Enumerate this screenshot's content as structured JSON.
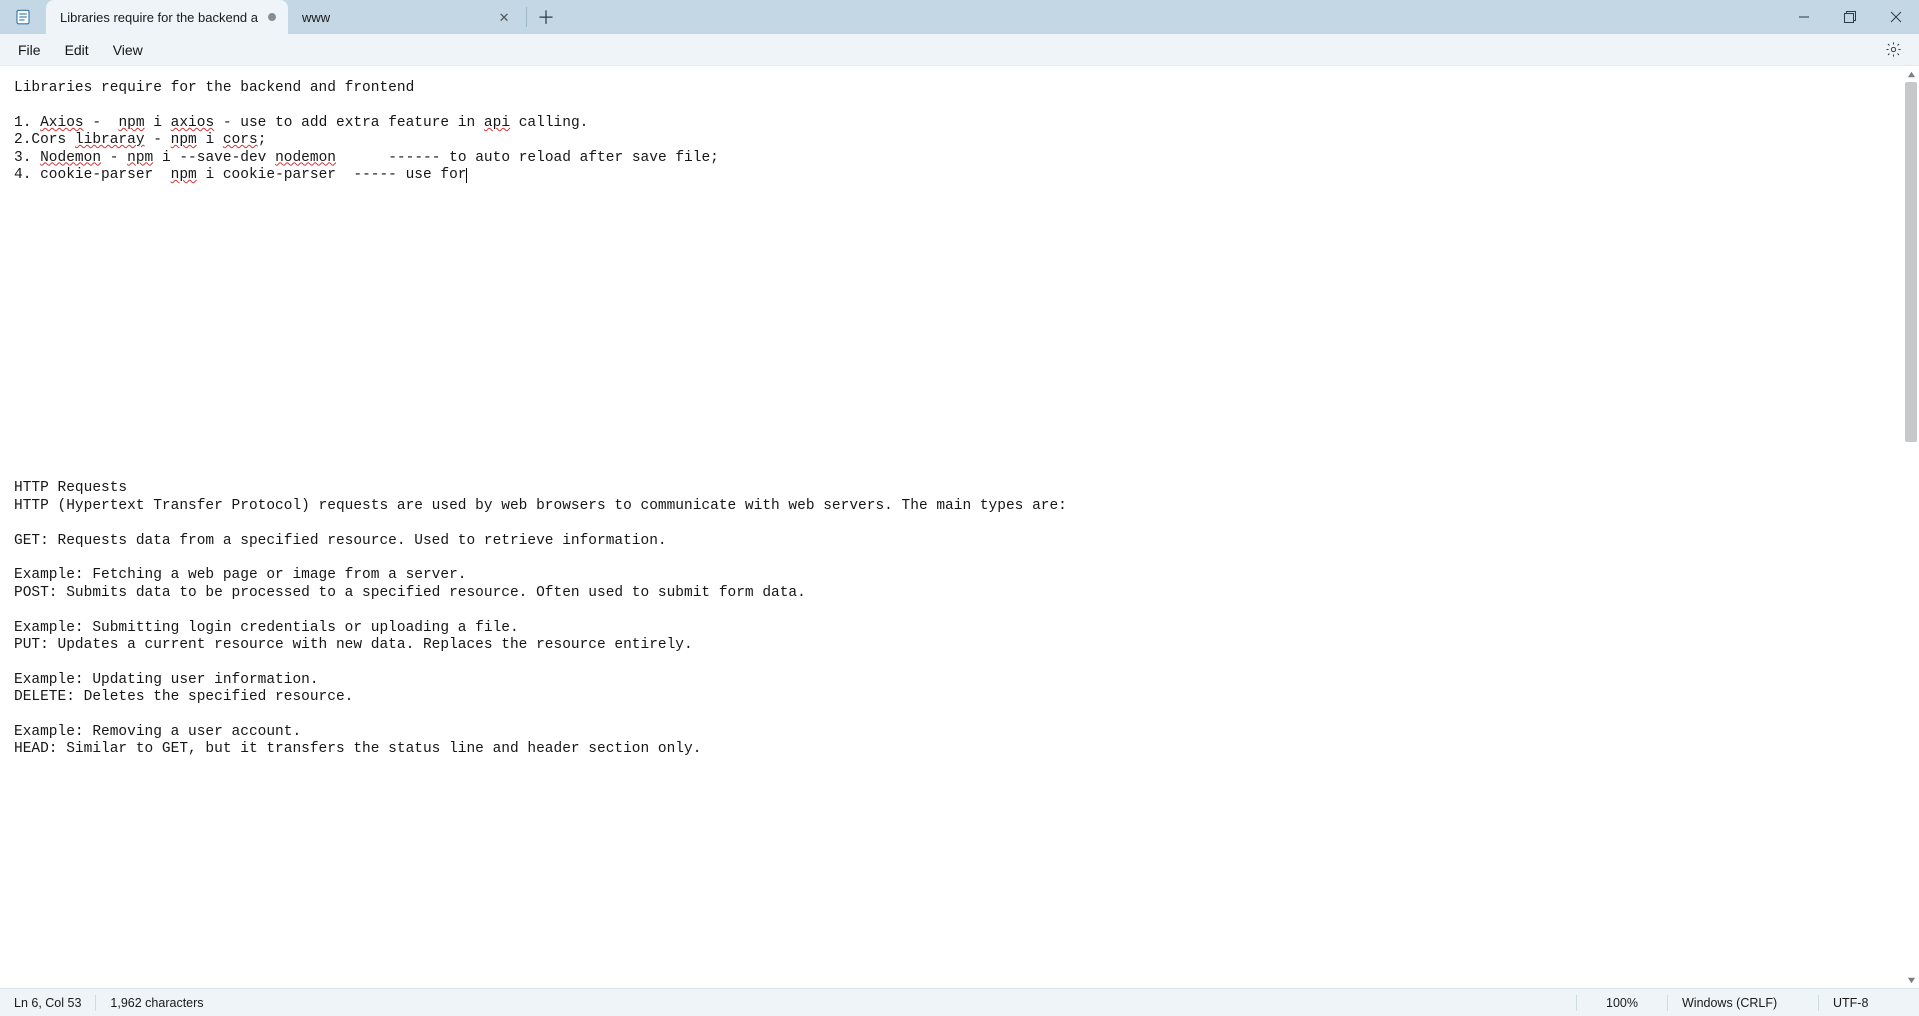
{
  "tabs": [
    {
      "label": "Libraries require for the backend a",
      "dirty": true
    },
    {
      "label": "www",
      "dirty": false
    }
  ],
  "menu": {
    "file": "File",
    "edit": "Edit",
    "view": "View"
  },
  "editor": {
    "lines": {
      "l1": "Libraries require for the backend and frontend",
      "l2": "",
      "l3_a": "1. ",
      "l3_axios": "Axios",
      "l3_b": " -  ",
      "l3_npm": "npm",
      "l3_c": " i ",
      "l3_axios2": "axios",
      "l3_d": " - use to add extra feature in ",
      "l3_api": "api",
      "l3_e": " calling.",
      "l4_a": "2.Cors ",
      "l4_lib": "libraray",
      "l4_b": " - ",
      "l4_npm": "npm",
      "l4_c": " i ",
      "l4_cors": "cors",
      "l4_d": ";",
      "l5_a": "3. ",
      "l5_nodemon": "Nodemon",
      "l5_b": " - ",
      "l5_npm": "npm",
      "l5_c": " i --save-dev ",
      "l5_nodemon2": "nodemon",
      "l5_d": "      ------ to auto reload after save file;",
      "l6_a": "4. cookie-parser  ",
      "l6_npm": "npm",
      "l6_b": " i cookie-parser  ----- use for",
      "l30": "HTTP Requests",
      "l31": "HTTP (Hypertext Transfer Protocol) requests are used by web browsers to communicate with web servers. The main types are:",
      "l33": "GET: Requests data from a specified resource. Used to retrieve information.",
      "l35": "Example: Fetching a web page or image from a server.",
      "l36": "POST: Submits data to be processed to a specified resource. Often used to submit form data.",
      "l38": "Example: Submitting login credentials or uploading a file.",
      "l39": "PUT: Updates a current resource with new data. Replaces the resource entirely.",
      "l41": "Example: Updating user information.",
      "l42": "DELETE: Deletes the specified resource.",
      "l44": "Example: Removing a user account.",
      "l45": "HEAD: Similar to GET, but it transfers the status line and header section only."
    }
  },
  "status": {
    "pos": "Ln 6, Col 53",
    "chars": "1,962 characters",
    "zoom": "100%",
    "eol": "Windows (CRLF)",
    "encoding": "UTF-8"
  }
}
